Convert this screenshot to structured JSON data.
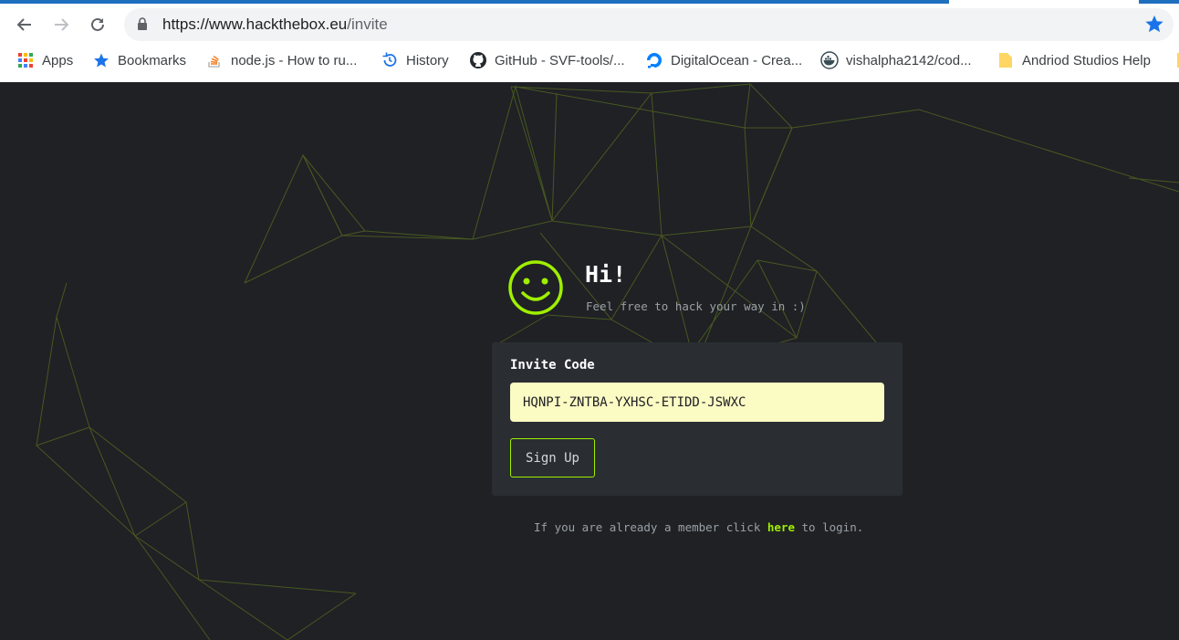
{
  "browser": {
    "url_host": "https://www.hackthebox.eu",
    "url_path": "/invite",
    "bookmarks": [
      {
        "label": "Apps",
        "icon": "apps-grid-icon"
      },
      {
        "label": "Bookmarks",
        "icon": "star-icon"
      },
      {
        "label": "node.js - How to ru...",
        "icon": "stackoverflow-icon"
      },
      {
        "label": "History",
        "icon": "history-icon"
      },
      {
        "label": "GitHub - SVF-tools/...",
        "icon": "github-icon"
      },
      {
        "label": "DigitalOcean - Crea...",
        "icon": "digitalocean-icon"
      },
      {
        "label": "vishalpha2142/cod...",
        "icon": "docker-icon"
      },
      {
        "label": "Andriod Studios Help",
        "icon": "folder-icon"
      }
    ]
  },
  "page": {
    "greeting": "Hi!",
    "subtitle": "Feel free to hack your way in :)",
    "form": {
      "label": "Invite Code",
      "code_value": "HQNPI-ZNTBA-YXHSC-ETIDD-JSWXC",
      "button": "Sign Up"
    },
    "login": {
      "before": "If you are already a member click ",
      "link": "here",
      "after": " to login."
    }
  },
  "colors": {
    "accent": "#9fef00",
    "background": "#1f2125",
    "card": "#2a2e33",
    "input": "#fbfbc4"
  }
}
